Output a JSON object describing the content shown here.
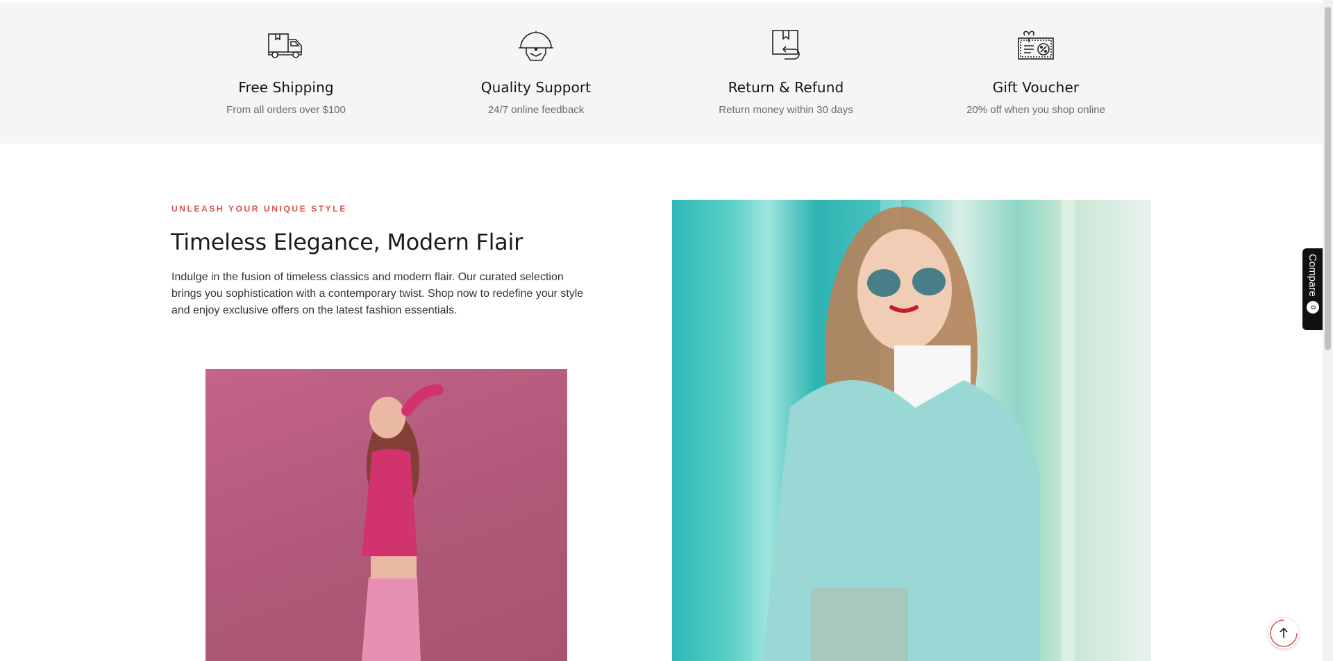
{
  "features": [
    {
      "icon": "delivery-truck-icon",
      "title": "Free Shipping",
      "subtitle": "From all orders over $100"
    },
    {
      "icon": "support-agent-icon",
      "title": "Quality Support",
      "subtitle": "24/7 online feedback"
    },
    {
      "icon": "return-box-icon",
      "title": "Return & Refund",
      "subtitle": "Return money within 30 days"
    },
    {
      "icon": "gift-voucher-icon",
      "title": "Gift Voucher",
      "subtitle": "20% off when you shop online"
    }
  ],
  "promo": {
    "eyebrow": "UNLEASH YOUR UNIQUE STYLE",
    "heading": "Timeless Elegance, Modern Flair",
    "body": "Indulge in the fusion of timeless classics and modern flair. Our curated selection brings you sophistication with a contemporary twist. Shop now to redefine your style and enjoy exclusive offers on the latest fashion essentials."
  },
  "compare": {
    "label": "Compare",
    "count": "0"
  },
  "colors": {
    "accent": "#d9534f",
    "features_bg": "#f5f5f5",
    "pink_backdrop": "#b85a7e",
    "teal_backdrop": "#2fb8b8"
  }
}
